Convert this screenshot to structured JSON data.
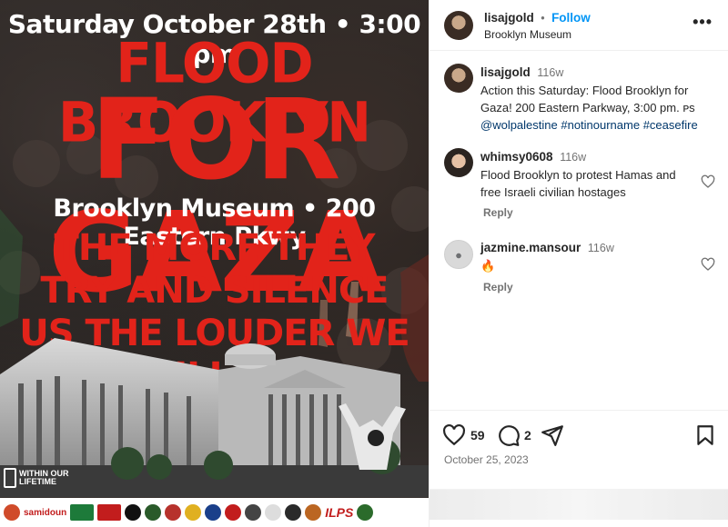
{
  "poster": {
    "date_line": "Saturday October 28th • 3:00 pm",
    "headline_1": "FLOOD BROOKLYN",
    "headline_2": "FOR GAZA",
    "venue_line": "Brooklyn Museum • 200 Eastern Pkwy",
    "slogan": "THE MORE THEY TRY AND SILENCE US THE LOUDER WE WILL BE",
    "brand_left": "WITHIN OUR LIFETIME",
    "sponsor_1": "samidoun",
    "sponsor_2": "ILPS",
    "colors": {
      "red": "#e2231a",
      "white": "#ffffff"
    }
  },
  "post": {
    "author": {
      "username": "lisajgold",
      "location": "Brooklyn Museum",
      "follow_label": "Follow",
      "separator": "•"
    },
    "more_icon": "more-horizontal-icon",
    "caption": {
      "username": "lisajgold",
      "age": "116w",
      "text": "Action this Saturday: Flood Brooklyn for Gaza! 200 Eastern Parkway, 3:00 pm. ᴘs",
      "tags": "@wolpalestine #notinourname #ceasefire"
    },
    "comments": [
      {
        "username": "whimsy0608",
        "age": "116w",
        "text": "Flood Brooklyn to protest Hamas and free Israeli civilian hostages",
        "reply_label": "Reply"
      },
      {
        "username": "jazmine.mansour",
        "age": "116w",
        "text": "🔥",
        "reply_label": "Reply"
      }
    ],
    "likes_count": "59",
    "comments_count": "2",
    "date": "October 25, 2023",
    "colors": {
      "link": "#0095f6",
      "text": "#262626",
      "muted": "#737373"
    }
  }
}
